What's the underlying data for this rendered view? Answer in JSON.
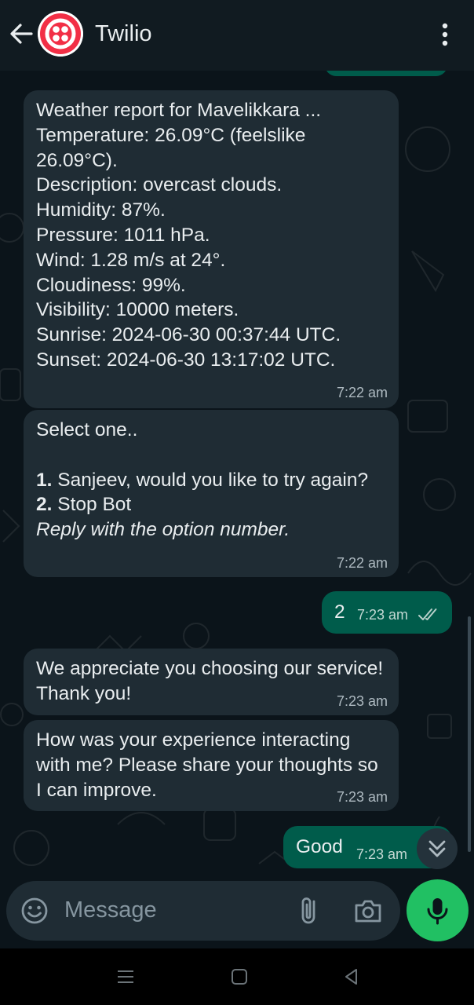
{
  "header": {
    "title": "Twilio"
  },
  "messages": [
    {
      "direction": "incoming",
      "text": "Weather report for Mavelikkara ...\nTemperature: 26.09°C (feelslike 26.09°C).\nDescription: overcast clouds.\nHumidity: 87%.\nPressure: 1011 hPa.\nWind: 1.28 m/s at 24°.\nCloudiness: 99%.\nVisibility: 10000 meters.\nSunrise: 2024-06-30 00:37:44 UTC.\nSunset: 2024-06-30 13:17:02 UTC.",
      "time": "7:22 am"
    },
    {
      "direction": "incoming",
      "intro": "Select one..",
      "options": [
        {
          "num": "1.",
          "label": " Sanjeev, would you like to try again?"
        },
        {
          "num": "2.",
          "label": " Stop Bot"
        }
      ],
      "note": "Reply with the option number.",
      "time": "7:22 am"
    },
    {
      "direction": "outgoing",
      "text": "2",
      "time": "7:23 am",
      "status": "read"
    },
    {
      "direction": "incoming",
      "text": "We appreciate you choosing our service! Thank you!",
      "time": "7:23 am"
    },
    {
      "direction": "incoming",
      "text": "How was your experience interacting with me? Please share your thoughts so I can improve.",
      "time": "7:23 am"
    },
    {
      "direction": "outgoing",
      "text": "Good",
      "time": "7:23 am"
    }
  ],
  "composer": {
    "placeholder": "Message"
  },
  "icons": {
    "back": "arrow-left-icon",
    "avatar": "twilio-logo",
    "menu": "more-vert-icon",
    "emoji": "emoji-icon",
    "attach": "paperclip-icon",
    "camera": "camera-icon",
    "mic": "mic-icon",
    "scroll": "double-chevron-down-icon",
    "read": "double-check-icon"
  },
  "colors": {
    "background": "#0b141a",
    "header": "#111b21",
    "incoming_bubble": "#1f2c34",
    "outgoing_bubble": "#005c4b",
    "accent": "#21c063",
    "twilio_red": "#f22f46"
  }
}
